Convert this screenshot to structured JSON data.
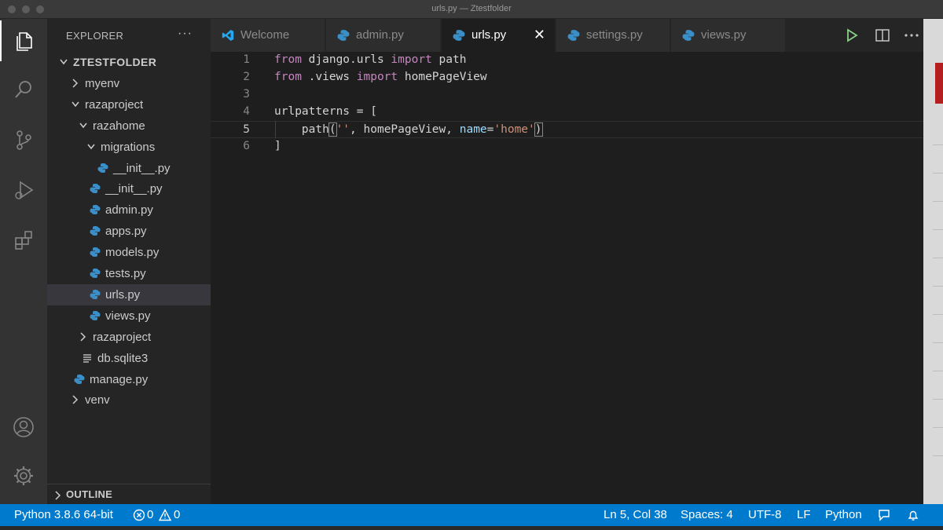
{
  "window": {
    "title": "urls.py — Ztestfolder"
  },
  "activity_bar": {
    "icons": [
      "files-icon",
      "search-icon",
      "source-control-icon",
      "run-debug-icon",
      "extensions-icon",
      "accounts-icon",
      "settings-gear-icon"
    ]
  },
  "sidebar": {
    "title": "EXPLORER",
    "more": "···",
    "tree": [
      {
        "label": "ZTESTFOLDER",
        "type": "root",
        "expanded": true
      },
      {
        "label": "myenv",
        "type": "folder",
        "expanded": false
      },
      {
        "label": "razaproject",
        "type": "folder",
        "expanded": true
      },
      {
        "label": "razahome",
        "type": "folder",
        "expanded": true
      },
      {
        "label": "migrations",
        "type": "folder",
        "expanded": true
      },
      {
        "label": "__init__.py",
        "type": "python"
      },
      {
        "label": "__init__.py",
        "type": "python"
      },
      {
        "label": "admin.py",
        "type": "python"
      },
      {
        "label": "apps.py",
        "type": "python"
      },
      {
        "label": "models.py",
        "type": "python"
      },
      {
        "label": "tests.py",
        "type": "python"
      },
      {
        "label": "urls.py",
        "type": "python",
        "selected": true
      },
      {
        "label": "views.py",
        "type": "python"
      },
      {
        "label": "razaproject",
        "type": "folder",
        "expanded": false
      },
      {
        "label": "db.sqlite3",
        "type": "database"
      },
      {
        "label": "manage.py",
        "type": "python"
      },
      {
        "label": "venv",
        "type": "folder",
        "expanded": false
      }
    ],
    "outline": "OUTLINE"
  },
  "tabs": [
    {
      "label": "Welcome",
      "icon": "vscode-icon"
    },
    {
      "label": "admin.py",
      "icon": "python-icon"
    },
    {
      "label": "urls.py",
      "icon": "python-icon",
      "active": true,
      "close": "✕"
    },
    {
      "label": "settings.py",
      "icon": "python-icon"
    },
    {
      "label": "views.py",
      "icon": "python-icon"
    }
  ],
  "tab_actions": [
    "run-icon",
    "split-editor-icon",
    "more-actions-icon"
  ],
  "editor": {
    "current_line": 5,
    "lines": [
      {
        "n": "1",
        "parts": [
          [
            "kw",
            "from"
          ],
          [
            "p",
            " django.urls "
          ],
          [
            "kw",
            "import"
          ],
          [
            "p",
            " path"
          ]
        ]
      },
      {
        "n": "2",
        "parts": [
          [
            "kw",
            "from"
          ],
          [
            "p",
            " .views "
          ],
          [
            "kw",
            "import"
          ],
          [
            "p",
            " homePageView"
          ]
        ]
      },
      {
        "n": "3",
        "parts": []
      },
      {
        "n": "4",
        "parts": [
          [
            "p",
            "urlpatterns = ["
          ]
        ]
      },
      {
        "n": "5",
        "parts": [
          [
            "p",
            "    path"
          ],
          [
            "b",
            "("
          ],
          [
            "str",
            "''"
          ],
          [
            "p",
            ", homePageView, "
          ],
          [
            "param",
            "name"
          ],
          [
            "p",
            "="
          ],
          [
            "str",
            "'home'"
          ],
          [
            "b",
            ")"
          ]
        ]
      },
      {
        "n": "6",
        "parts": [
          [
            "p",
            "]"
          ]
        ]
      }
    ]
  },
  "status_bar": {
    "interpreter": "Python 3.8.6 64-bit",
    "errors": "0",
    "warnings": "0",
    "cursor": "Ln 5, Col 38",
    "indent": "Spaces: 4",
    "encoding": "UTF-8",
    "eol": "LF",
    "language": "Python"
  },
  "colors": {
    "accent": "#007acc",
    "keyword": "#c586c0",
    "string": "#ce9178",
    "parameter": "#9cdcfe",
    "python_icon": "#3b8fc8",
    "run_icon": "#89d185"
  }
}
